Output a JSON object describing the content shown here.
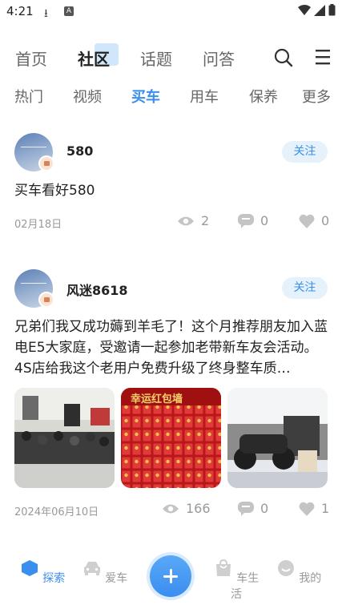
{
  "status_bar": {
    "time": "4:21",
    "download_icon": "download-icon",
    "app_badge": "A"
  },
  "top_nav": {
    "tabs": [
      "首页",
      "社区",
      "话题",
      "问答"
    ],
    "active": "社区"
  },
  "sub_nav": {
    "tabs": [
      "热门",
      "视频",
      "买车",
      "用车",
      "保养",
      "更多"
    ],
    "active": "买车"
  },
  "posts": [
    {
      "user": "580",
      "follow": "关注",
      "text": "买车看好580",
      "date": "02月18日",
      "views": "2",
      "comments": "0",
      "likes": "0"
    },
    {
      "user": "风迷8618",
      "follow": "关注",
      "text": "兄弟们我又成功薅到羊毛了！这个月推荐朋友加入蓝电E5大家庭，受邀请一起参加老带新车友会活动。4S店给我这个老用户免费升级了终身整车质…",
      "date": "2024年06月10日",
      "views": "166",
      "comments": "0",
      "likes": "1",
      "photo_banner": "幸运红包墙"
    }
  ],
  "bottom_nav": {
    "items": [
      "探索",
      "爱车",
      "车生活",
      "我的"
    ],
    "active": "探索"
  },
  "colors": {
    "accent": "#3a8ef0",
    "muted": "#999999"
  }
}
